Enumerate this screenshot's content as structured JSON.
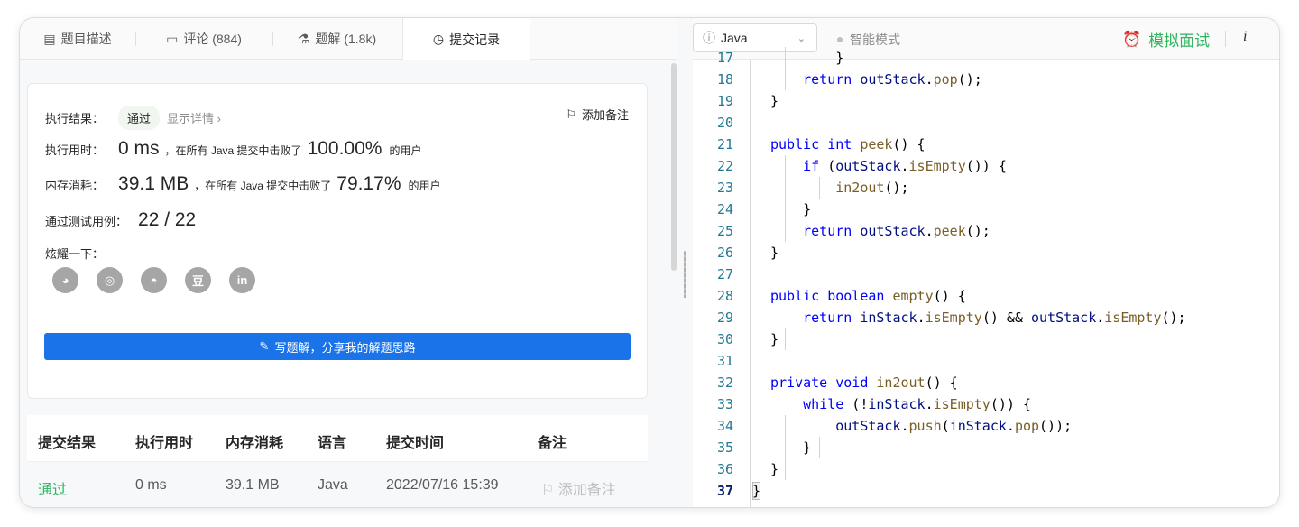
{
  "tabs": [
    {
      "icon": "▤",
      "label": "题目描述"
    },
    {
      "icon": "▭",
      "label": "评论 (884)"
    },
    {
      "icon": "⚗",
      "label": "题解 (1.8k)"
    },
    {
      "icon": "◷",
      "label": "提交记录"
    }
  ],
  "result": {
    "status_label": "执行结果：",
    "status": "通过",
    "detail_link": "显示详情 ›",
    "add_note": "添加备注",
    "time_label": "执行用时：",
    "time_value": "0 ms",
    "time_text": "，在所有 Java 提交中击败了",
    "time_pct": "100.00%",
    "time_suffix": "的用户",
    "mem_label": "内存消耗：",
    "mem_value": "39.1 MB",
    "mem_text": "，在所有 Java 提交中击败了",
    "mem_pct": "79.17%",
    "mem_suffix": "的用户",
    "tests_label": "通过测试用例：",
    "tests_value": "22 / 22",
    "share_label": "炫耀一下：",
    "share_icons": [
      "wechat-icon",
      "weibo-icon",
      "qq-icon",
      "douban-icon",
      "linkedin-icon"
    ],
    "share_glyphs": [
      "◕",
      "◎",
      "◓",
      "豆",
      "in"
    ],
    "write_button": "写题解，分享我的解题思路"
  },
  "submissions": {
    "headers": [
      "提交结果",
      "执行用时",
      "内存消耗",
      "语言",
      "提交时间",
      "备注"
    ],
    "rows": [
      {
        "result": "通过",
        "time": "0 ms",
        "memory": "39.1 MB",
        "lang": "Java",
        "submitted": "2022/07/16 15:39",
        "note": "添加备注"
      }
    ]
  },
  "editor_toolbar": {
    "language": "Java",
    "smart_mode": "智能模式",
    "mock_interview": "模拟面试",
    "info": "i"
  },
  "code": {
    "line_numbers": [
      "17",
      "18",
      "19",
      "20",
      "21",
      "22",
      "23",
      "24",
      "25",
      "26",
      "27",
      "28",
      "29",
      "30",
      "31",
      "32",
      "33",
      "34",
      "35",
      "36",
      "37"
    ],
    "current_line": "37"
  },
  "colors": {
    "accent_green": "#2db55d",
    "button_blue": "#1a73e8",
    "keyword": "#0000ff",
    "function": "#795e26",
    "variable": "#001080",
    "line_number": "#237893"
  }
}
